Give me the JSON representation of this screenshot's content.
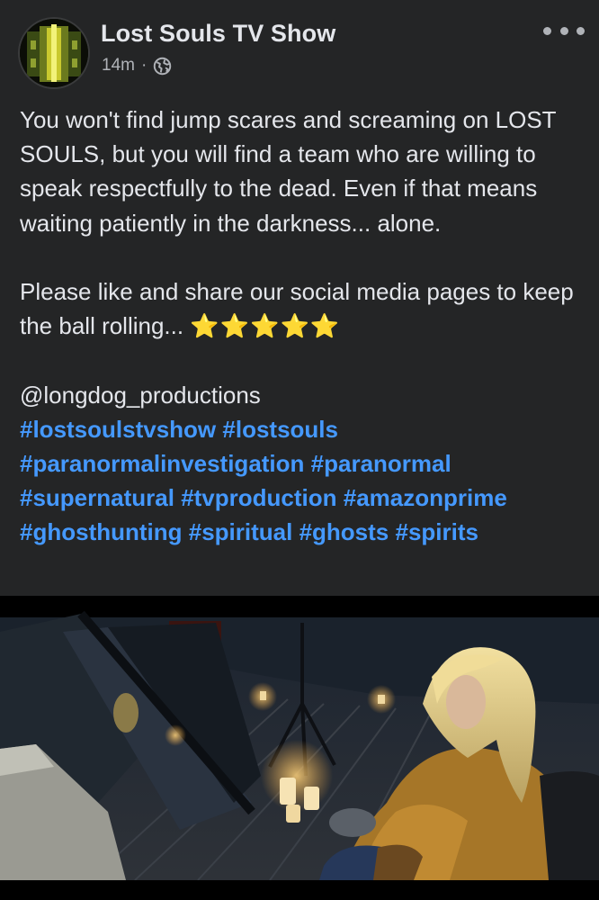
{
  "post": {
    "page_name": "Lost Souls TV Show",
    "timestamp": "14m",
    "separator": "·",
    "privacy_icon": "globe-icon",
    "more_icon": "more-options-icon",
    "paragraphs": [
      "You won't find jump scares and screaming on LOST SOULS, but you will find a team who are willing to speak respectfully to the dead. Even if that means waiting patiently in the darkness... alone.",
      "Please like and share our social media pages to keep the ball rolling..."
    ],
    "stars": "⭐⭐⭐⭐⭐",
    "mention": "@longdog_productions",
    "hashtags": [
      "#lostsoulstvshow",
      "#lostsouls",
      "#paranormalinvestigation",
      "#paranormal",
      "#supernatural",
      "#tvproduction",
      "#amazonprime",
      "#ghosthunting",
      "#spiritual",
      "#ghosts",
      "#spirits"
    ]
  },
  "colors": {
    "background": "#242526",
    "text": "#e4e6eb",
    "secondary_text": "#b0b3b8",
    "hashtag": "#4599ff",
    "star": "#f7b928"
  }
}
